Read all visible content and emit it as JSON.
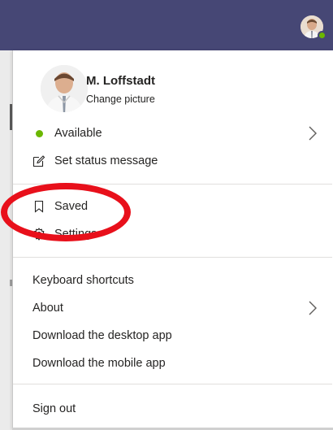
{
  "profile": {
    "name": "M. Loffstadt",
    "change_picture": "Change picture"
  },
  "status": {
    "available": "Available",
    "set_status_message": "Set status message"
  },
  "menu": {
    "saved": "Saved",
    "settings": "Settings",
    "keyboard_shortcuts": "Keyboard shortcuts",
    "about": "About",
    "download_desktop": "Download the desktop app",
    "download_mobile": "Download the mobile app",
    "sign_out": "Sign out"
  },
  "icons": {
    "presence": "presence-available-icon",
    "status_message": "edit-status-icon",
    "saved": "bookmark-icon",
    "settings": "gear-icon",
    "chevron": "chevron-right-icon"
  },
  "colors": {
    "topbar": "#464775",
    "presence_available": "#6bb700",
    "annotation_red": "#e8101b"
  }
}
